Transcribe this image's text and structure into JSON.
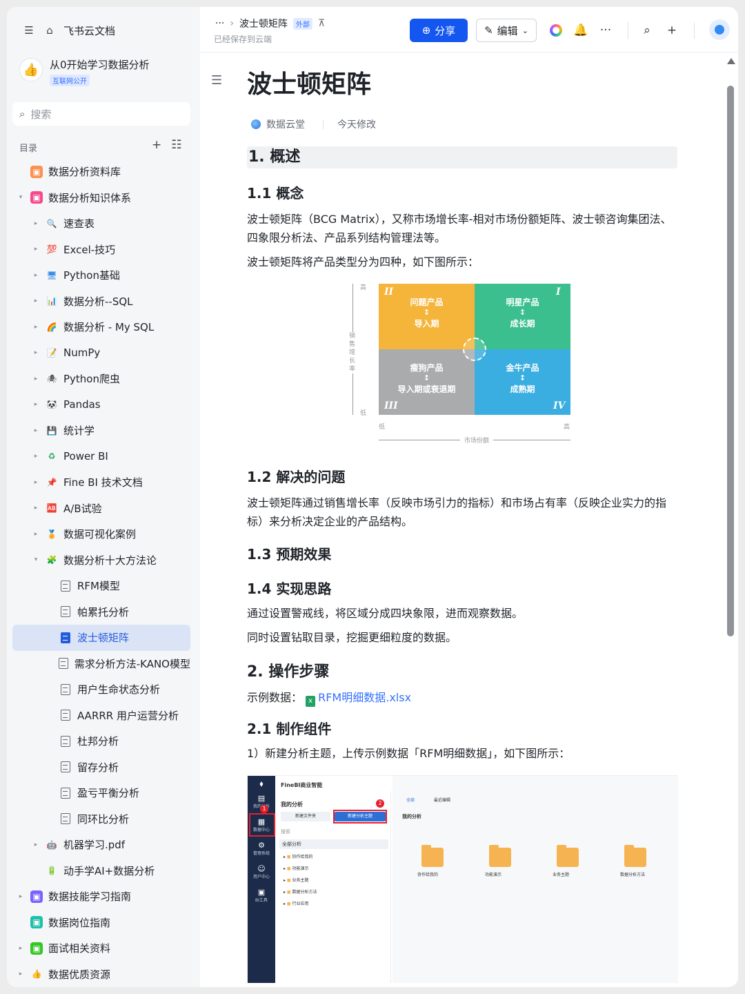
{
  "sidebar": {
    "app_name": "飞书云文档",
    "space_title": "从0开始学习数据分析",
    "space_tag": "互联网公开",
    "search_placeholder": "搜索",
    "toc_label": "目录",
    "items": [
      {
        "label": "数据分析资料库",
        "level": 0,
        "arrow": "",
        "icon": "wiki-orange-icon",
        "color": "#ff8f4d",
        "glyph": "◈"
      },
      {
        "label": "数据分析知识体系",
        "level": 0,
        "arrow": "▾",
        "icon": "wiki-pink-icon",
        "color": "#f54a8c",
        "glyph": "◈"
      },
      {
        "label": "速查表",
        "level": 1,
        "arrow": "▸",
        "icon": "magnifier-icon",
        "color": "#2a7ae2",
        "glyph": "🔍"
      },
      {
        "label": "Excel-技巧",
        "level": 1,
        "arrow": "▸",
        "icon": "hundred-icon",
        "color": "#e5202c",
        "glyph": "💯"
      },
      {
        "label": "Python基础",
        "level": 1,
        "arrow": "▸",
        "icon": "monitor-icon",
        "color": "#3a8ee6",
        "glyph": "🖥"
      },
      {
        "label": "数据分析--SQL",
        "level": 1,
        "arrow": "▸",
        "icon": "bar-chart-icon",
        "color": "#2a7ae2",
        "glyph": "📊"
      },
      {
        "label": "数据分析 - My SQL",
        "level": 1,
        "arrow": "▸",
        "icon": "rainbow-icon",
        "color": "#f0a020",
        "glyph": "🌈"
      },
      {
        "label": "NumPy",
        "level": 1,
        "arrow": "▸",
        "icon": "memo-icon",
        "color": "#d0a060",
        "glyph": "📝"
      },
      {
        "label": "Python爬虫",
        "level": 1,
        "arrow": "▸",
        "icon": "spider-icon",
        "color": "#555",
        "glyph": "🕷"
      },
      {
        "label": "Pandas",
        "level": 1,
        "arrow": "▸",
        "icon": "panda-icon",
        "color": "#333",
        "glyph": "🐼"
      },
      {
        "label": "统计学",
        "level": 1,
        "arrow": "▸",
        "icon": "floppy-icon",
        "color": "#6b3fa0",
        "glyph": "💾"
      },
      {
        "label": "Power BI",
        "level": 1,
        "arrow": "▸",
        "icon": "recycle-icon",
        "color": "#1fa35c",
        "glyph": "♻"
      },
      {
        "label": "Fine BI 技术文档",
        "level": 1,
        "arrow": "▸",
        "icon": "pin-icon",
        "color": "#e5202c",
        "glyph": "📌"
      },
      {
        "label": "A/B试验",
        "level": 1,
        "arrow": "▸",
        "icon": "ab-icon",
        "color": "#e5202c",
        "glyph": "🆎"
      },
      {
        "label": "数据可视化案例",
        "level": 1,
        "arrow": "▸",
        "icon": "medal-icon",
        "color": "#e0a000",
        "glyph": "🏅"
      },
      {
        "label": "数据分析十大方法论",
        "level": 1,
        "arrow": "▾",
        "icon": "puzzle-icon",
        "color": "#7cc242",
        "glyph": "🧩"
      },
      {
        "label": "RFM模型",
        "level": 2,
        "arrow": "",
        "icon": "document-icon",
        "glyph": "doc"
      },
      {
        "label": "帕累托分析",
        "level": 2,
        "arrow": "",
        "icon": "document-icon",
        "glyph": "doc"
      },
      {
        "label": "波士顿矩阵",
        "level": 2,
        "arrow": "",
        "icon": "document-icon",
        "glyph": "doc",
        "selected": true
      },
      {
        "label": "需求分析方法-KANO模型",
        "level": 2,
        "arrow": "",
        "icon": "document-icon",
        "glyph": "doc"
      },
      {
        "label": "用户生命状态分析",
        "level": 2,
        "arrow": "",
        "icon": "document-icon",
        "glyph": "doc"
      },
      {
        "label": "AARRR 用户运营分析",
        "level": 2,
        "arrow": "",
        "icon": "document-icon",
        "glyph": "doc"
      },
      {
        "label": "杜邦分析",
        "level": 2,
        "arrow": "",
        "icon": "document-icon",
        "glyph": "doc"
      },
      {
        "label": "留存分析",
        "level": 2,
        "arrow": "",
        "icon": "document-icon",
        "glyph": "doc"
      },
      {
        "label": "盈亏平衡分析",
        "level": 2,
        "arrow": "",
        "icon": "document-icon",
        "glyph": "doc"
      },
      {
        "label": "同环比分析",
        "level": 2,
        "arrow": "",
        "icon": "document-icon",
        "glyph": "doc"
      },
      {
        "label": "机器学习.pdf",
        "level": 1,
        "arrow": "▸",
        "icon": "robot-icon",
        "color": "#555",
        "glyph": "🤖"
      },
      {
        "label": "动手学AI+数据分析",
        "level": 1,
        "arrow": "",
        "icon": "battery-icon",
        "color": "#2a2",
        "glyph": "🔋"
      },
      {
        "label": "数据技能学习指南",
        "level": 0,
        "arrow": "▸",
        "icon": "wiki-purple-icon",
        "color": "#7b61ff",
        "glyph": "◈"
      },
      {
        "label": "数据岗位指南",
        "level": 0,
        "arrow": "",
        "icon": "wiki-teal-icon",
        "color": "#1fbfa9",
        "glyph": "◈"
      },
      {
        "label": "面试相关资料",
        "level": 0,
        "arrow": "▸",
        "icon": "wiki-green-icon",
        "color": "#34c724",
        "glyph": "◈"
      },
      {
        "label": "数据优质资源",
        "level": 0,
        "arrow": "▸",
        "icon": "thumbs-up-icon",
        "color": "#ffb800",
        "glyph": "👍"
      }
    ]
  },
  "topbar": {
    "more": "···",
    "breadcrumb_doc": "波士顿矩阵",
    "external_tag": "外部",
    "saved_status": "已经保存到云端",
    "share_label": "分享",
    "edit_label": "编辑",
    "overflow": "···"
  },
  "doc": {
    "title": "波士顿矩阵",
    "owner": "数据云堂",
    "modified": "今天修改",
    "h1_overview": "1. 概述",
    "h_concept": "1.1 概念",
    "p_concept_1": "波士顿矩阵（BCG Matrix），又称市场增长率-相对市场份额矩阵、波士顿咨询集团法、四象限分析法、产品系列结构管理法等。",
    "p_concept_2": "波士顿矩阵将产品类型分为四种，如下图所示：",
    "h_problem": "1.2 解决的问题",
    "p_problem": "波士顿矩阵通过销售增长率（反映市场引力的指标）和市场占有率（反映企业实力的指标）来分析决定企业的产品结构。",
    "h_effect": "1.3 预期效果",
    "h_approach": "1.4 实现思路",
    "p_approach_1": "通过设置警戒线，将区域分成四块象限，进而观察数据。",
    "p_approach_2": "同时设置钻取目录，挖掘更细粒度的数据。",
    "h_steps": "2. 操作步骤",
    "sample_label": "示例数据：",
    "sample_file": "RFM明细数据.xlsx",
    "h_component": "2.1 制作组件",
    "p_component": "1）新建分析主题，上传示例数据「RFM明细数据」，如下图所示："
  },
  "bcg": {
    "y_label": "销售增长率",
    "y_high": "高",
    "y_low": "低",
    "x_label": "市场份额",
    "x_low": "低",
    "x_high": "高",
    "quadrants": [
      {
        "roman": "II",
        "name": "问题产品",
        "stage": "导入期",
        "color": "#f5b43a"
      },
      {
        "roman": "I",
        "name": "明星产品",
        "stage": "成长期",
        "color": "#3bbf8e"
      },
      {
        "roman": "III",
        "name": "瘦狗产品",
        "stage": "导入期或衰退期",
        "color": "#a9abad"
      },
      {
        "roman": "IV",
        "name": "金牛产品",
        "stage": "成熟期",
        "color": "#3aaee0"
      }
    ]
  },
  "finebi": {
    "brand": "FineBI商业智能",
    "nav": [
      "我的分析",
      "数据中心",
      "管理系统",
      "用户中心",
      "BI工具"
    ],
    "my_analysis": "我的分析",
    "new_folder": "新建文件夹",
    "new_theme": "新建分析主题",
    "search": "搜索",
    "all_analysis": "全部分析",
    "tree": [
      "协作给我的",
      "功能演示",
      "业务主题",
      "数据分析方法",
      "行业应用"
    ],
    "tabs": [
      "全部",
      "最近编辑"
    ],
    "right_title": "我的分析",
    "folders": [
      "协作给我的",
      "功能演示",
      "业务主题",
      "数据分析方法"
    ],
    "badge_1": "1",
    "badge_2": "2"
  }
}
